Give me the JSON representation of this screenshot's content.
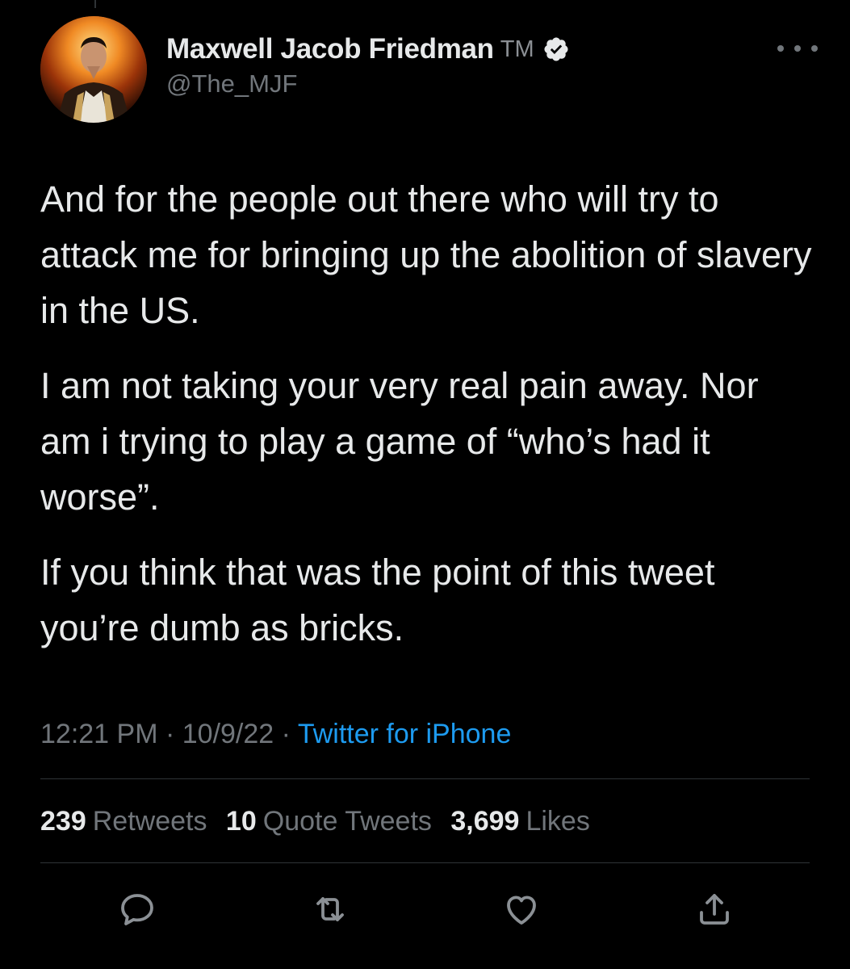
{
  "author": {
    "display_name": "Maxwell Jacob Friedman",
    "trademark": "TM",
    "handle": "@The_MJF",
    "verified_icon": "verified-badge-icon",
    "avatar_icon": "avatar-image"
  },
  "tweet": {
    "paragraphs": [
      "And for the people out there who will try to attack me for bringing up the abolition of slavery in the US.",
      "I am not taking your very real pain away. Nor am i trying to play a game of “who’s had it worse”.",
      "If you think that was the point of this tweet you’re dumb as bricks."
    ]
  },
  "meta": {
    "time": "12:21 PM",
    "separator": " · ",
    "date": "10/9/22",
    "source": "Twitter for iPhone"
  },
  "stats": {
    "retweets_count": "239",
    "retweets_label": "Retweets",
    "quotes_count": "10",
    "quotes_label": "Quote Tweets",
    "likes_count": "3,699",
    "likes_label": "Likes"
  },
  "actions": [
    {
      "icon": "reply-icon"
    },
    {
      "icon": "retweet-icon"
    },
    {
      "icon": "like-icon"
    },
    {
      "icon": "share-icon"
    }
  ],
  "colors": {
    "background": "#000000",
    "text": "#e7e9ea",
    "secondary": "#71767b",
    "accent": "#1d9bf0",
    "divider": "#2f3336"
  }
}
